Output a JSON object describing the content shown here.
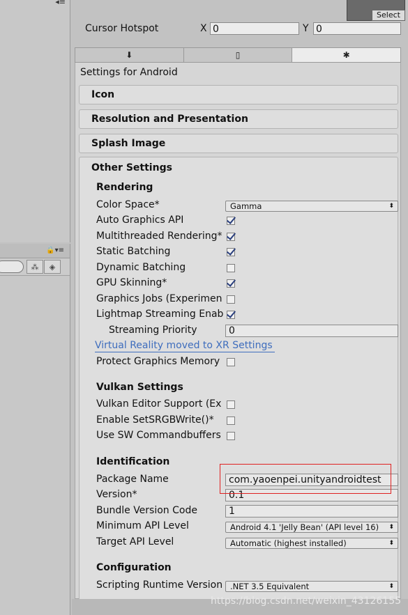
{
  "top": {
    "select_label": "Select",
    "cursor_hotspot": {
      "label": "Cursor Hotspot",
      "x_label": "X",
      "x_value": "0",
      "y_label": "Y",
      "y_value": "0"
    }
  },
  "platform_tabs": [
    {
      "name": "standalone",
      "icon": "download-arrow-icon",
      "glyph": "⬇"
    },
    {
      "name": "ios",
      "icon": "phone-icon",
      "glyph": "▯"
    },
    {
      "name": "android",
      "icon": "android-icon",
      "glyph": "✱"
    }
  ],
  "settings_title": "Settings for Android",
  "sections": {
    "icon": "Icon",
    "resolution": "Resolution and Presentation",
    "splash": "Splash Image",
    "other": "Other Settings"
  },
  "rendering": {
    "title": "Rendering",
    "color_space": {
      "label": "Color Space*",
      "value": "Gamma"
    },
    "auto_graphics_api": {
      "label": "Auto Graphics API",
      "checked": true
    },
    "multithreaded": {
      "label": "Multithreaded Rendering*",
      "checked": true
    },
    "static_batching": {
      "label": "Static Batching",
      "checked": true
    },
    "dynamic_batching": {
      "label": "Dynamic Batching",
      "checked": false
    },
    "gpu_skinning": {
      "label": "GPU Skinning*",
      "checked": true
    },
    "graphics_jobs": {
      "label": "Graphics Jobs (Experimen",
      "checked": false
    },
    "lightmap_streaming": {
      "label": "Lightmap Streaming Enab",
      "checked": true
    },
    "streaming_priority": {
      "label": "Streaming Priority",
      "value": "0"
    },
    "vr_link": "Virtual Reality moved to XR Settings",
    "protect_memory": {
      "label": "Protect Graphics Memory",
      "checked": false
    }
  },
  "vulkan": {
    "title": "Vulkan Settings",
    "editor_support": {
      "label": "Vulkan Editor Support (Ex",
      "checked": false
    },
    "srgb_write": {
      "label": "Enable SetSRGBWrite()*",
      "checked": false
    },
    "sw_commandbuffers": {
      "label": "Use SW Commandbuffers",
      "checked": false
    }
  },
  "identification": {
    "title": "Identification",
    "package_name": {
      "label": "Package Name",
      "value": "com.yaoenpei.unityandroidtest"
    },
    "version": {
      "label": "Version*",
      "value": "0.1"
    },
    "bundle_version_code": {
      "label": "Bundle Version Code",
      "value": "1"
    },
    "min_api": {
      "label": "Minimum API Level",
      "value": "Android 4.1 'Jelly Bean' (API level 16)"
    },
    "target_api": {
      "label": "Target API Level",
      "value": "Automatic (highest installed)"
    }
  },
  "configuration": {
    "title": "Configuration",
    "scripting_runtime": {
      "label": "Scripting Runtime Version",
      "value": ".NET 3.5 Equivalent"
    }
  },
  "watermark": "https://blog.csdn.net/weixin_43126155",
  "colors": {
    "highlight": "#e02020",
    "link": "#3e6dbd",
    "check": "#2a3f7d"
  }
}
